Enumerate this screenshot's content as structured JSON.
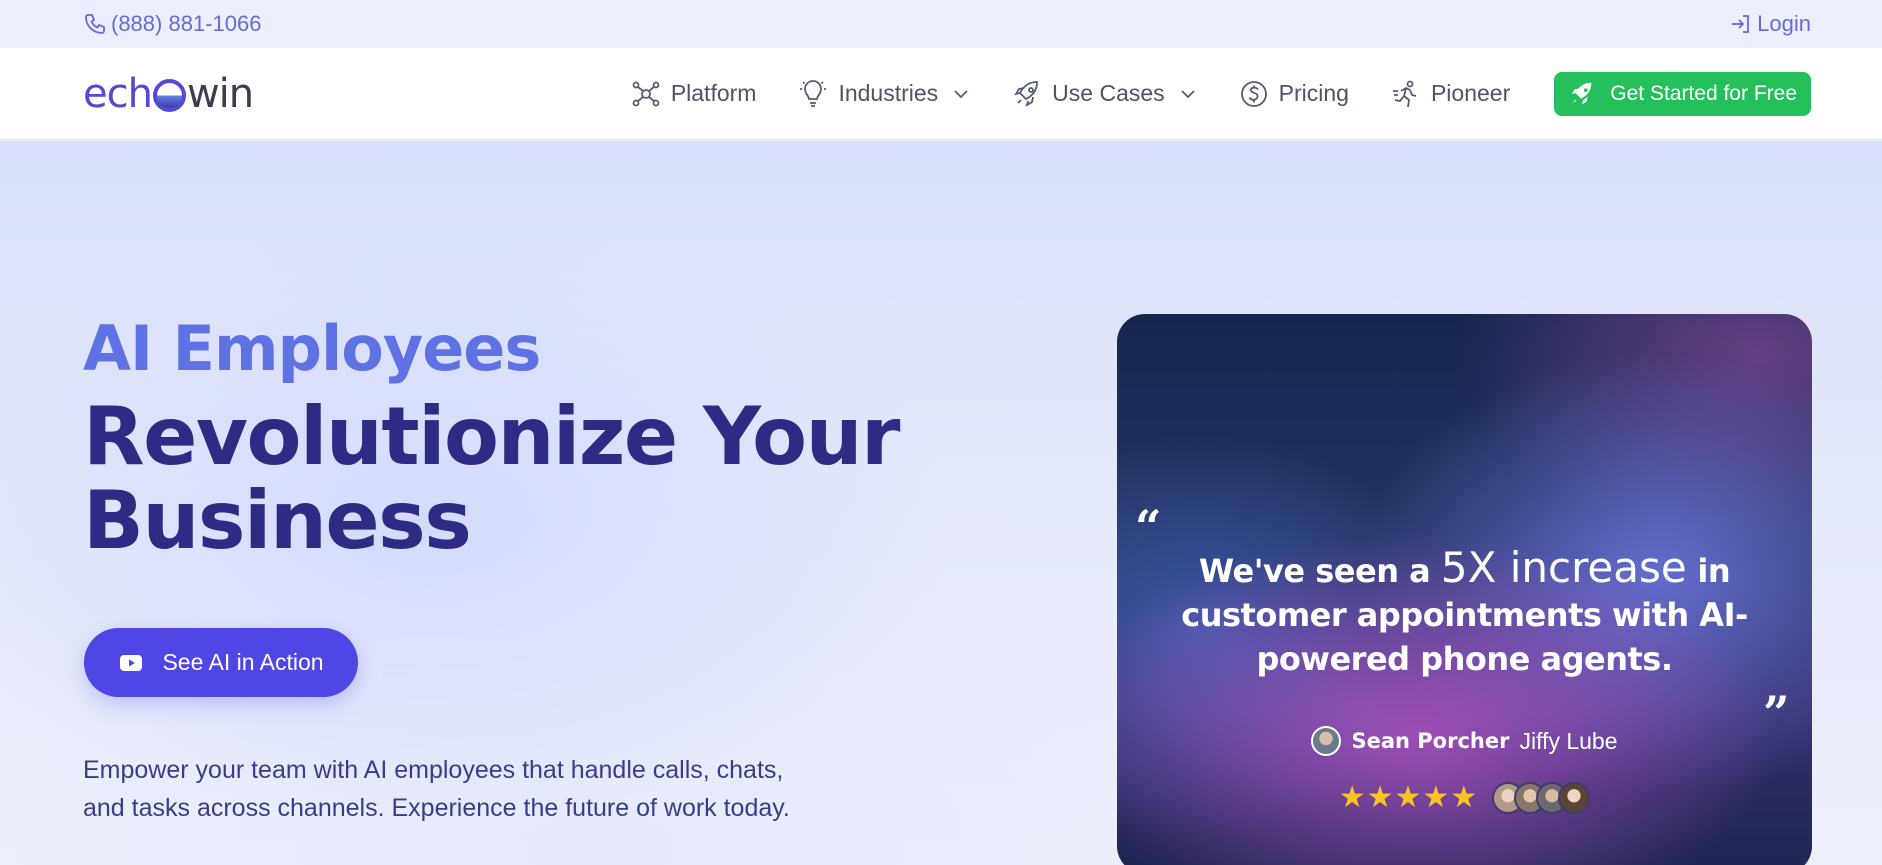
{
  "topbar": {
    "phone": "(888) 881-1066",
    "phone_icon": "phone-icon",
    "login": "Login",
    "login_icon": "login-icon"
  },
  "nav": {
    "logo": {
      "part1": "ech",
      "part2": "win"
    },
    "items": [
      {
        "label": "Platform",
        "icon": "network-icon",
        "dropdown": false
      },
      {
        "label": "Industries",
        "icon": "lightbulb-icon",
        "dropdown": true
      },
      {
        "label": "Use Cases",
        "icon": "rocket-icon",
        "dropdown": true
      },
      {
        "label": "Pricing",
        "icon": "dollar-circle-icon",
        "dropdown": false
      },
      {
        "label": "Pioneer",
        "icon": "running-person-icon",
        "dropdown": false
      }
    ],
    "cta": "Get Started for Free"
  },
  "hero": {
    "eyebrow": "AI Employees",
    "headline_line1": "Revolutionize Your",
    "headline_line2": "Business",
    "button": "See AI in Action",
    "subtext_line1": "Empower your team with AI employees that handle calls, chats,",
    "subtext_line2": "and tasks across channels. Experience the future of work today."
  },
  "testimonial": {
    "quote_pre": "We've seen a",
    "quote_highlight": "5X increase",
    "quote_post": "in customer appointments with AI-powered phone agents.",
    "author_name": "Sean Porcher",
    "author_company": "Jiffy Lube",
    "stars": "★★★★★",
    "rating": 5
  },
  "colors": {
    "accent": "#4f46e5",
    "cta_green": "#25c05b",
    "eyebrow": "#5f72e4",
    "headline": "#2f2b85"
  }
}
